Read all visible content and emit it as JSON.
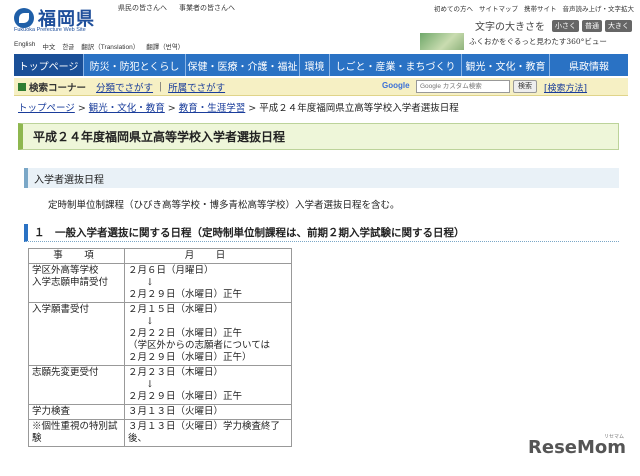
{
  "header": {
    "logo_text": "福岡県",
    "logo_sub": "Fukuoka Prefecture Web Site",
    "util_links": [
      "県民の皆さんへ",
      "事業者の皆さんへ"
    ],
    "util_right": [
      "初めての方へ",
      "サイトマップ",
      "携帯サイト",
      "音声読み上げ・文字拡大"
    ],
    "font_size_label": "文字の大きさを",
    "font_size_buttons": [
      "小さく",
      "普通",
      "大きく"
    ],
    "banner_text": "ふくおかをぐるっと見わたす360°ビュー",
    "lang_links": [
      "English",
      "中文",
      "한글",
      "翻訳（Translation）",
      "翻譯（번역）"
    ]
  },
  "nav": {
    "items": [
      "トップページ",
      "防災・防犯とくらし",
      "保健・医療・介護・福祉",
      "環境",
      "しごと・産業・まちづくり",
      "観光・文化・教育",
      "県政情報"
    ],
    "active_index": 0
  },
  "search": {
    "title": "検索コーナー",
    "by_category": "分類でさがす",
    "by_department": "所属でさがす",
    "google": "Google",
    "placeholder": "Google カスタム検索",
    "button": "検索",
    "help": "[検索方法]"
  },
  "breadcrumb": [
    "トップページ",
    "観光・文化・教育",
    "教育・生涯学習",
    "平成２４年度福岡県立高等学校入学者選抜日程"
  ],
  "page_title": "平成２４年度福岡県立高等学校入学者選抜日程",
  "section": {
    "heading": "入学者選抜日程",
    "note": "定時制単位制課程（ひびき高等学校・博多青松高等学校）入学者選抜日程を含む。",
    "subheading": "１　一般入学者選抜に関する日程（定時制単位制課程は、前期２期入学試験に関する日程）"
  },
  "schedule": {
    "headers": [
      "事　項",
      "月　日"
    ],
    "rows": [
      {
        "item": [
          "学区外高等学校",
          "入学志願申請受付"
        ],
        "dates": [
          "２月６日（月曜日）",
          "↓",
          "２月２９日（水曜日）正午"
        ]
      },
      {
        "item": [
          "入学願書受付"
        ],
        "dates": [
          "２月１５日（水曜日）",
          "↓",
          "２月２２日（水曜日）正午",
          "（学区外からの志願者については",
          "２月２９日（水曜日）正午）"
        ]
      },
      {
        "item": [
          "志願先変更受付"
        ],
        "dates": [
          "２月２３日（木曜日）",
          "↓",
          "２月２９日（水曜日）正午"
        ]
      },
      {
        "item": [
          "学力検査"
        ],
        "dates": [
          "３月１３日（火曜日）"
        ]
      },
      {
        "item": [
          "※個性重視の特別試験"
        ],
        "dates": [
          "３月１３日（火曜日）学力検査終了",
          "後、"
        ]
      }
    ]
  },
  "watermark": {
    "text": "ReseMom",
    "sub": "リセマム"
  }
}
